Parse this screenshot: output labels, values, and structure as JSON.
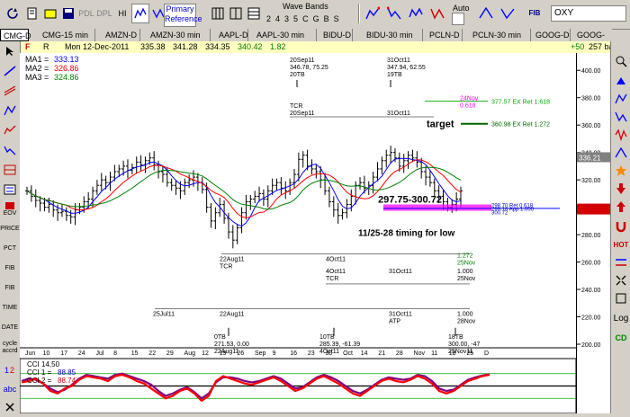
{
  "toolbar": {
    "ticker_input": "OXY",
    "primary_label": "Primary",
    "reference_label": "Reference",
    "wave_bands_label": "Wave Bands",
    "wave_numbers": [
      "2",
      "4",
      "3",
      "5",
      "C",
      "G",
      "B",
      "S"
    ],
    "auto_label": "Auto",
    "pdl_label": "PDL",
    "dpl_label": "DPL",
    "hi_label": "HI",
    "fib_label": "FIB"
  },
  "tabs": [
    "CMG-D",
    "CMG-15 min",
    "AMZN-D",
    "AMZN-30 min",
    "AAPL-D",
    "AAPL-30 min",
    "BIDU-D",
    "BIDU-30 min",
    "PCLN-D",
    "PCLN-30 min",
    "GOOG-D",
    "GOOG-"
  ],
  "info": {
    "flag": "F",
    "r": "R",
    "date": "Mon 12-Dec-2011",
    "open": "335.38",
    "high": "341.28",
    "low": "334.35",
    "close": "340.42",
    "change": "1.82",
    "plus": "+50",
    "bars": "257 bars"
  },
  "left_tools": [
    "EOV",
    "PRICE",
    "PCT",
    "FIB",
    "FIB",
    "TIME",
    "DATE",
    "cycle accrd",
    "abc"
  ],
  "right_tools": [
    "HOT",
    "Log",
    "CD"
  ],
  "ma_legend": [
    {
      "label": "MA1 =",
      "value": "333.13",
      "color": "#0000ff"
    },
    {
      "label": "MA2 =",
      "value": "326.86",
      "color": "#ff0000"
    },
    {
      "label": "MA3 =",
      "value": "324.86",
      "color": "#008000"
    }
  ],
  "cci_legend": [
    {
      "label": "CCI 14,50",
      "value": ""
    },
    {
      "label": "CCI 1 =",
      "value": "88.85"
    },
    {
      "label": "CCI 2 =",
      "value": "88.74"
    }
  ],
  "chart_data": {
    "type": "line",
    "title": "",
    "price_axis": {
      "min": 200,
      "max": 410,
      "ticks": [
        400,
        380,
        360,
        340,
        320,
        300,
        280,
        260,
        240,
        220,
        200
      ],
      "last_price": "336.21"
    },
    "x_labels": [
      "Jun",
      "10",
      "17",
      "24",
      "Jul",
      "8",
      "15",
      "22",
      "29",
      "Aug",
      "12",
      "19",
      "26",
      "Sep",
      "9",
      "16",
      "23",
      "30",
      "Oct",
      "14",
      "21",
      "28",
      "Nov",
      "11",
      "18",
      "25",
      "D"
    ],
    "annotations": {
      "top1": [
        "20Sep11",
        "346.78, 75.25",
        "20TB"
      ],
      "top2": [
        "31Oct11",
        "347.94, 62.55",
        "19TB"
      ],
      "tcr_top": [
        "TCR",
        "20Sep11"
      ],
      "tcr_top2": "31Oct11",
      "nov24": [
        "24Nov",
        "0.618"
      ],
      "ret1618": "377.57 EX Ret 1.618",
      "ret1272": "360.98 EX Ret 1.272",
      "target": "target",
      "range_text": "297.75-300.72",
      "timing_text": "11/25-28 timing for low",
      "aug22_tcr": [
        "22Aug11",
        "TCR"
      ],
      "oct4": "4Oct11",
      "nov25_1272": [
        "1.272",
        "25Nov"
      ],
      "oct4_tcr": [
        "4Oct11",
        "TCR"
      ],
      "oct31_mid": "31Oct11",
      "nov25_1000": [
        "1.000",
        "25Nov"
      ],
      "jul25": "25Jul11",
      "aug22": "22Aug11",
      "oct31_atp": [
        "31Oct11",
        "ATP"
      ],
      "nov28_1000": [
        "1.000",
        "28Nov"
      ],
      "tb0": [
        "0TB",
        "271.53, 0.00",
        "22Aug11"
      ],
      "tb10": [
        "10TB",
        "285.39, -61.39",
        "4Oct11"
      ],
      "tb18": [
        "18TB",
        "300.00, -47",
        "25Nov11"
      ],
      "right_levels": [
        "298.70 Ret 0.618",
        "299.18 App 1.000",
        "300.72"
      ]
    },
    "candles": [
      [
        0,
        312
      ],
      [
        1,
        308
      ],
      [
        2,
        305
      ],
      [
        3,
        303
      ],
      [
        4,
        300
      ],
      [
        5,
        302
      ],
      [
        6,
        298
      ],
      [
        7,
        296
      ],
      [
        8,
        297
      ],
      [
        9,
        294
      ],
      [
        10,
        293
      ],
      [
        11,
        298
      ],
      [
        12,
        300
      ],
      [
        13,
        304
      ],
      [
        14,
        306
      ],
      [
        15,
        312
      ],
      [
        16,
        316
      ],
      [
        17,
        320
      ],
      [
        18,
        318
      ],
      [
        19,
        322
      ],
      [
        20,
        326
      ],
      [
        21,
        328
      ],
      [
        22,
        330
      ],
      [
        23,
        327
      ],
      [
        24,
        329
      ],
      [
        25,
        333
      ],
      [
        26,
        331
      ],
      [
        27,
        334
      ],
      [
        28,
        336
      ],
      [
        29,
        331
      ],
      [
        30,
        326
      ],
      [
        31,
        324
      ],
      [
        32,
        318
      ],
      [
        33,
        316
      ],
      [
        34,
        314
      ],
      [
        35,
        312
      ],
      [
        36,
        318
      ],
      [
        37,
        320
      ],
      [
        38,
        322
      ],
      [
        39,
        318
      ],
      [
        40,
        313
      ],
      [
        41,
        300
      ],
      [
        42,
        290
      ],
      [
        43,
        296
      ],
      [
        44,
        302
      ],
      [
        45,
        292
      ],
      [
        46,
        282
      ],
      [
        47,
        276
      ],
      [
        48,
        285
      ],
      [
        49,
        296
      ],
      [
        50,
        304
      ],
      [
        51,
        306
      ],
      [
        52,
        308
      ],
      [
        53,
        310
      ],
      [
        54,
        306
      ],
      [
        55,
        312
      ],
      [
        56,
        316
      ],
      [
        57,
        318
      ],
      [
        58,
        314
      ],
      [
        59,
        312
      ],
      [
        60,
        318
      ],
      [
        61,
        324
      ],
      [
        62,
        335
      ],
      [
        63,
        338
      ],
      [
        64,
        330
      ],
      [
        65,
        328
      ],
      [
        66,
        326
      ],
      [
        67,
        320
      ],
      [
        68,
        312
      ],
      [
        69,
        304
      ],
      [
        70,
        298
      ],
      [
        71,
        294
      ],
      [
        72,
        296
      ],
      [
        73,
        302
      ],
      [
        74,
        308
      ],
      [
        75,
        316
      ],
      [
        76,
        318
      ],
      [
        77,
        314
      ],
      [
        78,
        316
      ],
      [
        79,
        322
      ],
      [
        80,
        328
      ],
      [
        81,
        334
      ],
      [
        82,
        338
      ],
      [
        83,
        340
      ],
      [
        84,
        336
      ],
      [
        85,
        330
      ],
      [
        86,
        334
      ],
      [
        87,
        338
      ],
      [
        88,
        336
      ],
      [
        89,
        333
      ],
      [
        90,
        326
      ],
      [
        91,
        322
      ],
      [
        92,
        318
      ],
      [
        93,
        312
      ],
      [
        94,
        308
      ],
      [
        95,
        304
      ],
      [
        96,
        300
      ],
      [
        97,
        302
      ],
      [
        98,
        306
      ],
      [
        99,
        312
      ]
    ],
    "cci1": [
      30,
      40,
      60,
      20,
      -40,
      -60,
      -20,
      0,
      50,
      80,
      70,
      60,
      40,
      80,
      90,
      70,
      40,
      20,
      -20,
      -60,
      -100,
      -80,
      -40,
      -20,
      -60,
      -120,
      -80,
      40,
      80,
      60,
      40,
      20,
      10,
      30,
      50,
      70,
      40,
      0,
      -40,
      -20,
      20,
      60,
      80,
      50,
      20,
      -20,
      -60,
      -80,
      -40,
      0,
      40,
      60,
      40,
      30,
      50,
      80,
      60,
      20,
      -40,
      -60,
      -40,
      0,
      40,
      60,
      80,
      90
    ],
    "cci2": [
      40,
      60,
      50,
      20,
      -20,
      -50,
      -30,
      10,
      60,
      90,
      80,
      70,
      60,
      90,
      100,
      80,
      60,
      40,
      10,
      -40,
      -80,
      -60,
      -30,
      -10,
      -50,
      -100,
      -60,
      30,
      70,
      70,
      60,
      40,
      30,
      40,
      60,
      80,
      60,
      20,
      -20,
      -10,
      30,
      70,
      90,
      70,
      40,
      0,
      -40,
      -60,
      -30,
      10,
      50,
      70,
      60,
      50,
      60,
      90,
      80,
      40,
      -20,
      -40,
      -30,
      10,
      50,
      70,
      85,
      95
    ]
  },
  "colors": {
    "ma1": "#0000ff",
    "ma2": "#ff0000",
    "ma3": "#008000",
    "cci1": "#ff0000",
    "cci2": "#800080",
    "ret1618": "#00aa00",
    "ret1272": "#006600",
    "nov24": "#ff00ff",
    "range_band": "#ff00ff"
  }
}
